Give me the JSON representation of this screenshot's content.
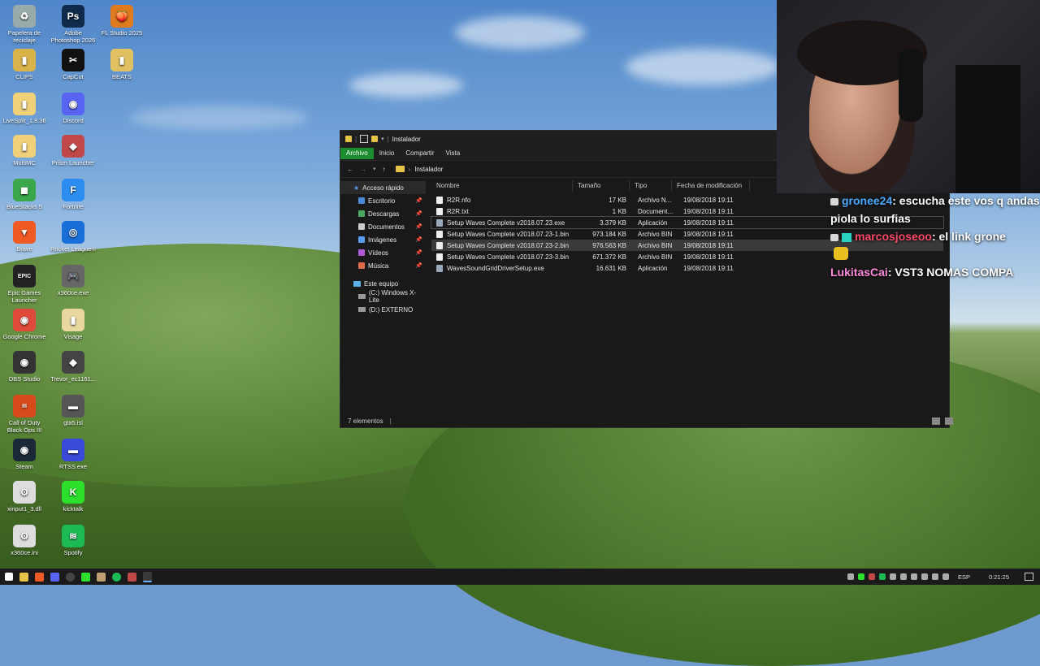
{
  "desktop": {
    "icons": [
      {
        "label": "Papelera de reciclaje",
        "glyph": "♻",
        "color": "#9aa"
      },
      {
        "label": "Adobe Photoshop 2026",
        "glyph": "Ps",
        "color": "#0f2a4a"
      },
      {
        "label": "FL Studio 2025",
        "glyph": "🍑",
        "color": "#e07a1f"
      },
      {
        "label": "CLIPS",
        "glyph": "▮",
        "color": "#d9b24a"
      },
      {
        "label": "CapCut",
        "glyph": "✂",
        "color": "#111"
      },
      {
        "label": "BEATS",
        "glyph": "▮",
        "color": "#e0c060"
      },
      {
        "label": "LiveSplit_1.8.36",
        "glyph": "▮",
        "color": "#f0d078"
      },
      {
        "label": "Discord",
        "glyph": "◉",
        "color": "#5865f2"
      },
      {
        "label": "MultiMC",
        "glyph": "▮",
        "color": "#f0d078"
      },
      {
        "label": "Prism Launcher",
        "glyph": "◆",
        "color": "#c04848"
      },
      {
        "label": "BlueStacks 5",
        "glyph": "◼",
        "color": "#3aa84a"
      },
      {
        "label": "Fortnite",
        "glyph": "F",
        "color": "#2c8df0"
      },
      {
        "label": "Brave",
        "glyph": "▼",
        "color": "#f05a24"
      },
      {
        "label": "Rocket League®",
        "glyph": "◎",
        "color": "#1a6ed8"
      },
      {
        "label": "Epic Games Launcher",
        "glyph": "EPIC",
        "color": "#222"
      },
      {
        "label": "x360ce.exe",
        "glyph": "🎮",
        "color": "#666"
      },
      {
        "label": "Google Chrome",
        "glyph": "◉",
        "color": "#e04a3a"
      },
      {
        "label": "Visage",
        "glyph": "▮",
        "color": "#e8d8a0"
      },
      {
        "label": "OBS Studio",
        "glyph": "◉",
        "color": "#333"
      },
      {
        "label": "Trevor_ec1161...",
        "glyph": "◆",
        "color": "#444"
      },
      {
        "label": "Call of Duty Black Ops III",
        "glyph": "III",
        "color": "#d84a1a"
      },
      {
        "label": "gta5.isl",
        "glyph": "▬",
        "color": "#555"
      },
      {
        "label": "Steam",
        "glyph": "◉",
        "color": "#1b2838"
      },
      {
        "label": "RTSS.exe",
        "glyph": "▬",
        "color": "#3a4ad8"
      },
      {
        "label": "xinput1_3.dll",
        "glyph": "⚙",
        "color": "#ddd"
      },
      {
        "label": "kicktalk",
        "glyph": "K",
        "color": "#2ce02c"
      },
      {
        "label": "x360ce.ini",
        "glyph": "⚙",
        "color": "#ddd"
      },
      {
        "label": "Spotify",
        "glyph": "≋",
        "color": "#1db954"
      }
    ]
  },
  "explorer": {
    "title": "Instalador",
    "ribbon_tabs": [
      "Archivo",
      "Inicio",
      "Compartir",
      "Vista"
    ],
    "breadcrumb": "Instalador",
    "nav": {
      "quick_access": "Acceso rápido",
      "items": [
        "Escritorio",
        "Descargas",
        "Documentos",
        "Imágenes",
        "Vídeos",
        "Música"
      ],
      "this_pc": "Este equipo",
      "drives": [
        "(C:) Windows X-Lite",
        "(D:) EXTERNO"
      ]
    },
    "columns": {
      "name": "Nombre",
      "size": "Tamaño",
      "type": "Tipo",
      "modified": "Fecha de modificación"
    },
    "files": [
      {
        "name": "R2R.nfo",
        "size": "17 KB",
        "type": "Archivo N...",
        "date": "19/08/2018 19:11"
      },
      {
        "name": "R2R.txt",
        "size": "1 KB",
        "type": "Document...",
        "date": "19/08/2018 19:11"
      },
      {
        "name": "Setup Waves Complete v2018.07.23.exe",
        "size": "3.379 KB",
        "type": "Aplicación",
        "date": "19/08/2018 19:11"
      },
      {
        "name": "Setup Waves Complete v2018.07.23-1.bin",
        "size": "973.184 KB",
        "type": "Archivo BIN",
        "date": "19/08/2018 19:11"
      },
      {
        "name": "Setup Waves Complete v2018.07.23-2.bin",
        "size": "976.563 KB",
        "type": "Archivo BIN",
        "date": "19/08/2018 19:11"
      },
      {
        "name": "Setup Waves Complete v2018.07.23-3.bin",
        "size": "671.372 KB",
        "type": "Archivo BIN",
        "date": "19/08/2018 19:11"
      },
      {
        "name": "WavesSoundGridDriverSetup.exe",
        "size": "16.631 KB",
        "type": "Aplicación",
        "date": "19/08/2018 19:11"
      }
    ],
    "status": "7 elementos"
  },
  "chat": [
    {
      "user": "gronee24",
      "user_color": "#4aa8ff",
      "message": ": escucha este vos q andas piola lo surfias"
    },
    {
      "user": "marcosjoseoo",
      "user_color": "#ff4a6a",
      "message": ": el link grone"
    },
    {
      "user": "LukitasCai",
      "user_color": "#ff8ad8",
      "message": ": VST3 NOMAS COMPA"
    }
  ],
  "taskbar": {
    "clock": "0:21:25",
    "lang": "ESP"
  }
}
